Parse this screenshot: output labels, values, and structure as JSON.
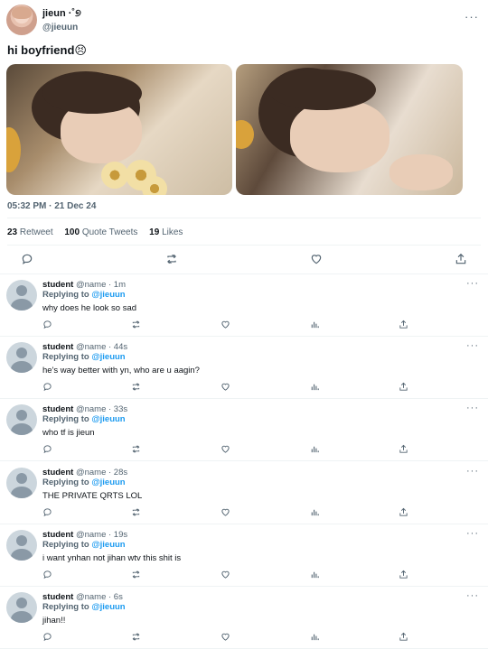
{
  "tweet": {
    "display_name": "jieun ·˚୭",
    "handle": "@jieuun",
    "text": "hi boyfriend😣",
    "timestamp": "05:32 PM · 21 Dec 24",
    "stats": {
      "retweets_count": "23",
      "retweets_label": "Retweet",
      "quotes_count": "100",
      "quotes_label": "Quote Tweets",
      "likes_count": "19",
      "likes_label": "Likes"
    },
    "more_label": "···"
  },
  "replies": [
    {
      "name": "student",
      "meta": "@name · 1m",
      "replying_prefix": "Replying to",
      "replying_to": "@jieuun",
      "text": "why does he look so sad"
    },
    {
      "name": "student",
      "meta": "@name · 44s",
      "replying_prefix": "Replying to",
      "replying_to": "@jieuun",
      "text": "he's way better with yn, who are u aagin?"
    },
    {
      "name": "student",
      "meta": "@name · 33s",
      "replying_prefix": "Replying to",
      "replying_to": "@jieuun",
      "text": "who tf is jieun"
    },
    {
      "name": "student",
      "meta": "@name · 28s",
      "replying_prefix": "Replying to",
      "replying_to": "@jieuun",
      "text": "THE PRIVATE QRTS LOL"
    },
    {
      "name": "student",
      "meta": "@name · 19s",
      "replying_prefix": "Replying to",
      "replying_to": "@jieuun",
      "text": "i want ynhan not jihan wtv this shit is"
    },
    {
      "name": "student",
      "meta": "@name · 6s",
      "replying_prefix": "Replying to",
      "replying_to": "@jieuun",
      "text": "jihan!!"
    }
  ],
  "icons": {
    "reply": "reply-icon",
    "retweet": "retweet-icon",
    "like": "heart-icon",
    "views": "views-icon",
    "share": "share-icon",
    "more": "more-icon"
  },
  "colors": {
    "accent": "#1d9bf0",
    "secondary_text": "#536471",
    "divider": "#eff3f4"
  }
}
